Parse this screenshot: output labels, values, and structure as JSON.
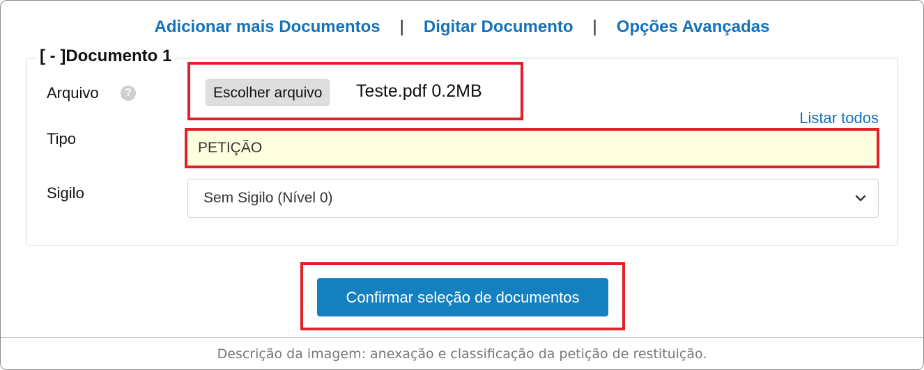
{
  "top_links": {
    "add_more": "Adicionar mais Documentos",
    "separator": "|",
    "type_document": "Digitar Documento",
    "advanced_options": "Opções Avançadas"
  },
  "document": {
    "toggle": "[ - ]",
    "title": "Documento 1",
    "file_label": "Arquivo",
    "help_glyph": "?",
    "choose_file_button": "Escolher arquivo",
    "file_name": "Teste.pdf 0.2MB",
    "list_all_link": "Listar todos",
    "type_label": "Tipo",
    "type_value": "PETIÇÃO",
    "secrecy_label": "Sigilo",
    "secrecy_value": "Sem Sigilo (Nível 0)"
  },
  "confirm_button": "Confirmar seleção de documentos",
  "caption": "Descrição da imagem: anexação e classificação da petição de restituição.",
  "colors": {
    "link": "#1571b9",
    "highlight_border": "#e0202a",
    "primary_button": "#1580c0",
    "type_field_bg": "#ffffdf"
  },
  "icons": [
    "help-icon",
    "chevron-down-icon"
  ]
}
